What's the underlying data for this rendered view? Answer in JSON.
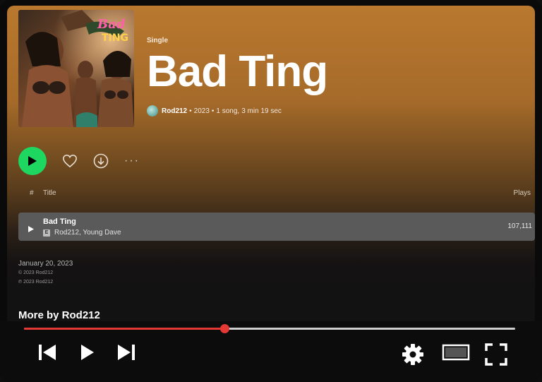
{
  "album": {
    "kind_label": "Single",
    "title": "Bad Ting",
    "artist": "Rod212",
    "year": "2023",
    "summary": "1 song,",
    "duration": "3 min 19 sec",
    "cover_text": "Bad TING"
  },
  "actions": {
    "play_icon": "play-icon",
    "like_icon": "heart-icon",
    "download_icon": "download-icon",
    "more_label": "···"
  },
  "tracklist": {
    "header": {
      "hash": "#",
      "title": "Title",
      "plays": "Plays"
    },
    "tracks": [
      {
        "name": "Bad Ting",
        "explicit": "E",
        "artists": "Rod212, Young Dave",
        "plays": "107,111"
      }
    ]
  },
  "footer": {
    "release_date": "January 20, 2023",
    "copyright_c": "© 2023 Rod212",
    "copyright_p": "℗ 2023 Rod212",
    "more_by": "More by Rod212"
  },
  "player": {
    "progress": 0.408,
    "accent": "#e53935",
    "icons": [
      "previous-icon",
      "play-icon",
      "next-icon",
      "settings-icon",
      "theater-mode-icon",
      "fullscreen-icon"
    ]
  },
  "colors": {
    "spotify_green": "#1ed760",
    "header_gradient_top": "#b9782e",
    "background": "#121212"
  }
}
